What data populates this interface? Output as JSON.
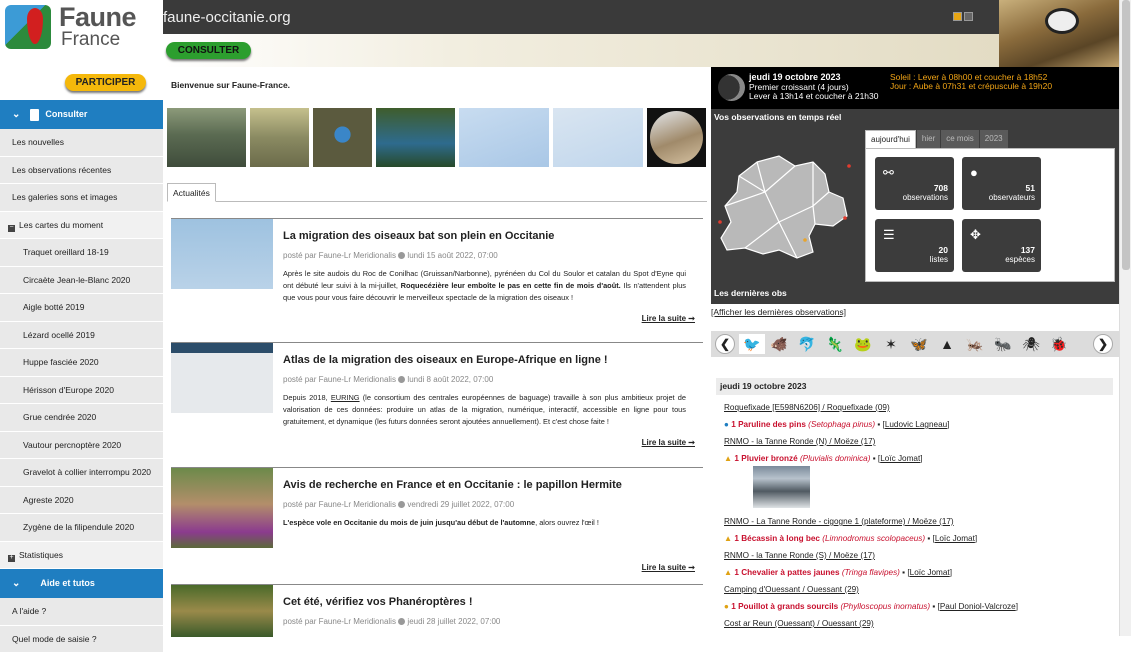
{
  "brand": {
    "line1": "Faune",
    "line2": "France"
  },
  "header": {
    "site": "faune-occitanie.org",
    "consult_label": "CONSULTER"
  },
  "sidebar": {
    "participate_label": "PARTICIPER",
    "consult_header": "Consulter",
    "items": [
      "Les nouvelles",
      "Les observations récentes",
      "Les galeries sons et images"
    ],
    "maps_header": "Les cartes du moment",
    "maps": [
      "Traquet oreillard 18-19",
      "Circaète Jean-le-Blanc 2020",
      "Aigle botté 2019",
      "Lézard ocellé 2019",
      "Huppe fasciée 2020",
      "Hérisson d'Europe 2020",
      "Grue cendrée 2020",
      "Vautour percnoptère 2020",
      "Gravelot à collier interrompu 2020",
      "Agreste 2020",
      "Zygène de la filipendule 2020"
    ],
    "stats_label": "Statistiques",
    "help_header": "Aide et tutos",
    "help_items": [
      "A l'aide ?",
      "Quel mode de saisie ?"
    ]
  },
  "main": {
    "welcome": "Bienvenue sur Faune-France.",
    "tab": "Actualités",
    "articles": [
      {
        "title": "La migration des oiseaux bat son plein en Occitanie",
        "meta": "posté par Faune-Lr Meridionalis",
        "date": "lundi 15 août 2022, 07:00",
        "p1": "Après le site audois du Roc de Conilhac (Gruissan/Narbonne), pyrénéen du Col du Soulor et catalan du Spot d'Eyne qui ont débuté leur suivi à la mi-juillet, ",
        "strong": "Roquecézière leur emboîte le pas en cette fin de mois d'août.",
        "p2": " Ils n'attendent plus que vous pour vous faire découvrir le merveilleux spectacle de la migration des oiseaux !",
        "more": "Lire la suite ➞"
      },
      {
        "title": "Atlas de la migration des oiseaux en Europe-Afrique en ligne !",
        "meta": "posté par Faune-Lr Meridionalis",
        "date": "lundi 8 août 2022, 07:00",
        "p1": "Depuis 2018, ",
        "link": "EURING",
        "p2": " (le consortium des centrales européennes de baguage) travaille à son plus ambitieux projet de valorisation de ces données: produire un atlas de la migration, numérique, interactif, accessible en ligne pour tous gratuitement, et dynamique (les futurs données seront ajoutées annuellement). Et c'est chose faite !",
        "more": "Lire la suite ➞"
      },
      {
        "title": "Avis de recherche en France et en Occitanie : le papillon Hermite",
        "meta": "posté par Faune-Lr Meridionalis",
        "date": "vendredi 29 juillet 2022, 07:00",
        "strong": "L'espèce vole en Occitanie du mois de juin jusqu'au début de l'automne",
        "p2": ", alors ouvrez l'œil !",
        "more": "Lire la suite ➞"
      },
      {
        "title": "Cet été, vérifiez vos Phanéroptères !",
        "meta": "posté par Faune-Lr Meridionalis",
        "date": "jeudi 28 juillet 2022, 07:00"
      }
    ]
  },
  "right": {
    "date": "jeudi 19 octobre 2023",
    "moon": "Premier croissant (4 jours)",
    "moonrise": "Lever à 13h14 et coucher à 21h30",
    "sun": "Soleil : Lever à 08h00 et coucher à 18h52",
    "day": "Jour : Aube à 07h31 et crépuscule à 19h20",
    "rt_title": "Vos observations en temps réel",
    "tabs": [
      "aujourd'hui",
      "hier",
      "ce mois",
      "2023"
    ],
    "stats": [
      {
        "n": "708",
        "l": "observations",
        "icon": "binoculars-icon",
        "g": "⚯"
      },
      {
        "n": "51",
        "l": "observateurs",
        "icon": "user-icon",
        "g": "●"
      },
      {
        "n": "20",
        "l": "listes",
        "icon": "list-icon",
        "g": "☰"
      },
      {
        "n": "137",
        "l": "espèces",
        "icon": "paw-icon",
        "g": "✥"
      }
    ],
    "last_title": "Les dernières obs",
    "show_label": "[Afficher les dernières observations]",
    "day_label": "jeudi 19 octobre 2023",
    "entries": [
      {
        "loc": "Roquefixade [E598N6206] / Roquefixade (09)"
      },
      {
        "count": "1",
        "species": "Paruline des pins",
        "latin": "(Setophaga pinus)",
        "observer": "Ludovic Lagneau"
      },
      {
        "loc": "RNMO - la Tanne Ronde (N) / Moëze (17)"
      },
      {
        "count": "1",
        "species": "Pluvier bronzé",
        "latin": "(Pluvialis dominica)",
        "observer": "Loïc Jomat"
      },
      {
        "loc": "RNMO - La Tanne Ronde - cigogne 1 (plateforme) / Moëze (17)"
      },
      {
        "count": "1",
        "species": "Bécassin à long bec",
        "latin": "(Limnodromus scolopaceus)",
        "observer": "Loïc Jomat"
      },
      {
        "loc": "RNMO - la Tanne Ronde (S) / Moëze (17)"
      },
      {
        "count": "1",
        "species": "Chevalier à pattes jaunes",
        "latin": "(Tringa flavipes)",
        "observer": "Loïc Jomat"
      },
      {
        "loc": "Camping d'Ouessant / Ouessant (29)"
      },
      {
        "count": "1",
        "species": "Pouillot à grands sourcils",
        "latin": "(Phylloscopus inornatus)",
        "observer": "Paul Doniol-Valcroze"
      },
      {
        "loc": "Cost ar Reun (Ouessant) / Ouessant (29)"
      }
    ]
  }
}
